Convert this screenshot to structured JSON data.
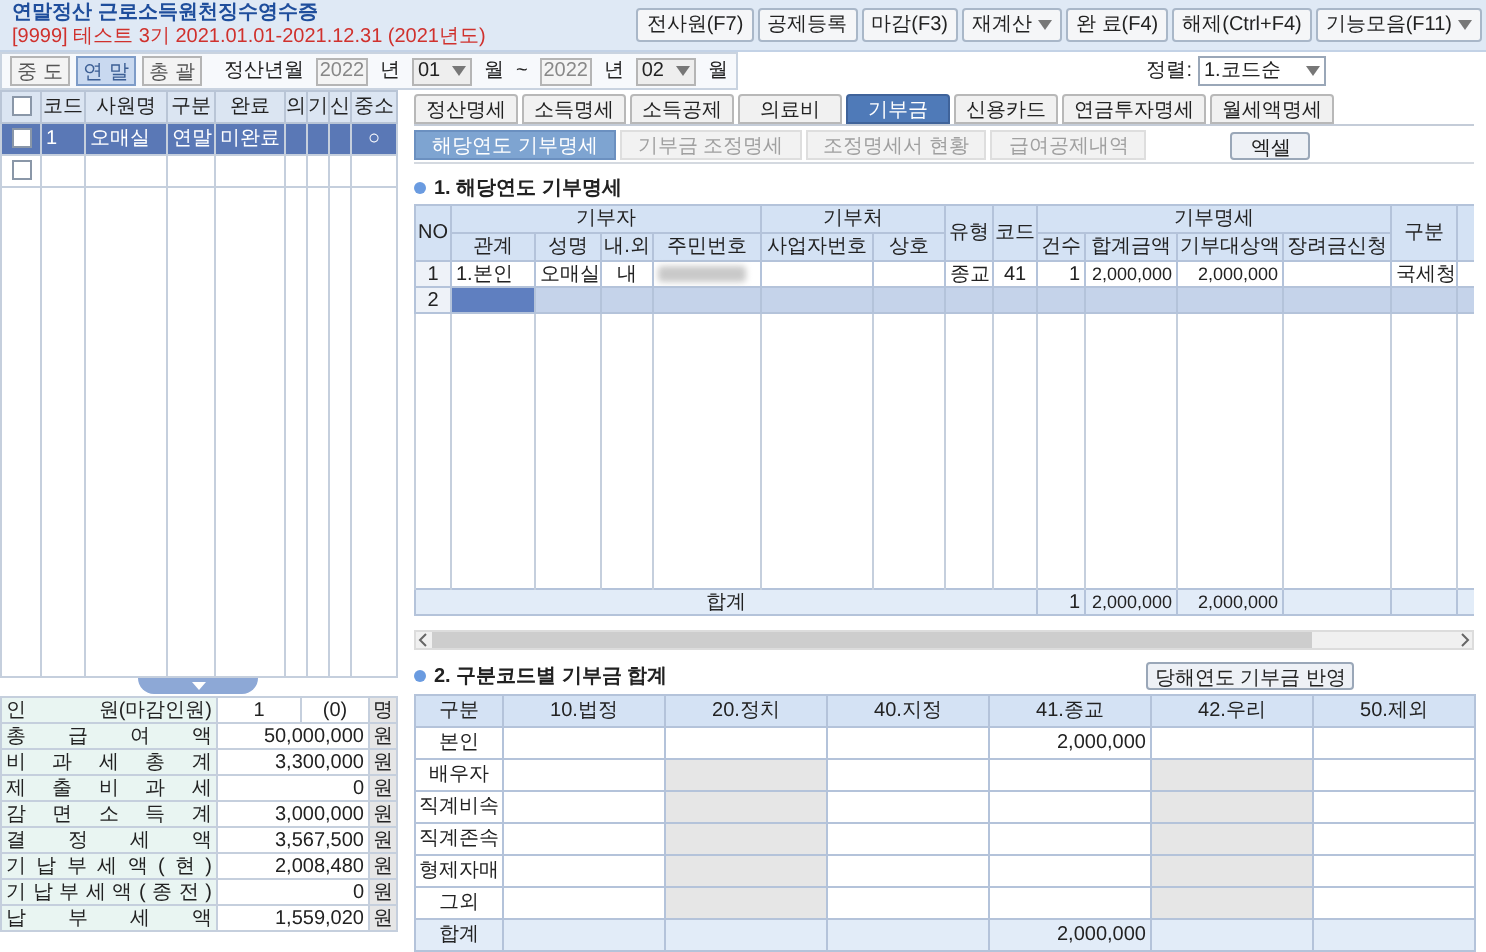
{
  "window": {
    "title": "연말정산 근로소득원천징수영수증",
    "company_period": "[9999] 테스트 3기 2021.01.01-2021.12.31 (2021년도)"
  },
  "toolbar": [
    {
      "label": "전사원(F7)",
      "dropdown": false
    },
    {
      "label": "공제등록",
      "dropdown": false
    },
    {
      "label": "마감(F3)",
      "dropdown": false
    },
    {
      "label": "재계산",
      "dropdown": true
    },
    {
      "label": "완 료(F4)",
      "dropdown": false
    },
    {
      "label": "해제(Ctrl+F4)",
      "dropdown": false
    },
    {
      "label": "기능모음(F11)",
      "dropdown": true
    }
  ],
  "modes": [
    {
      "label": "중 도",
      "selected": false
    },
    {
      "label": "연 말",
      "selected": true
    },
    {
      "label": "총 괄",
      "selected": false
    }
  ],
  "period": {
    "label": "정산년월",
    "from": {
      "year": "2022",
      "year_unit": "년",
      "month": "01",
      "month_unit": "월"
    },
    "separator": "~",
    "to": {
      "year": "2022",
      "year_unit": "년",
      "month": "02",
      "month_unit": "월"
    }
  },
  "sort": {
    "label": "정렬:",
    "value": "1.코드순"
  },
  "employees": {
    "all_checked": false,
    "columns": [
      "코드",
      "사원명",
      "구분",
      "완료",
      "의",
      "기",
      "신",
      "중소"
    ],
    "rows": [
      {
        "checked": false,
        "selected": true,
        "code": "1",
        "name": "오매실",
        "type": "연말",
        "status": "미완료",
        "sme": "○"
      },
      {
        "checked": false,
        "selected": false
      }
    ]
  },
  "summary": [
    {
      "label": "인 원(마감인원)",
      "value": "1",
      "value_2": "(0)",
      "unit": "명"
    },
    {
      "label": "총 급 여 액",
      "value": "50,000,000",
      "unit": "원"
    },
    {
      "label": "비 과 세 총 계",
      "value": "3,300,000",
      "unit": "원"
    },
    {
      "label": "제 출 비 과 세",
      "value": "0",
      "unit": "원"
    },
    {
      "label": "감 면 소 득 계",
      "value": "3,000,000",
      "unit": "원"
    },
    {
      "label": "결 정 세 액",
      "value": "3,567,500",
      "unit": "원"
    },
    {
      "label": "기 납 부 세 액 ( 현 )",
      "value": "2,008,480",
      "unit": "원"
    },
    {
      "label": "기 납 부 세 액 ( 종 전 )",
      "value": "0",
      "unit": "원"
    },
    {
      "label": "납 부 세 액",
      "value": "1,559,020",
      "unit": "원"
    }
  ],
  "tabs": [
    {
      "label": "정산명세",
      "selected": false
    },
    {
      "label": "소득명세",
      "selected": false
    },
    {
      "label": "소득공제",
      "selected": false
    },
    {
      "label": "의료비",
      "selected": false
    },
    {
      "label": "기부금",
      "selected": true
    },
    {
      "label": "신용카드",
      "selected": false
    },
    {
      "label": "연금투자명세",
      "selected": false
    },
    {
      "label": "월세액명세",
      "selected": false
    }
  ],
  "subtabs": [
    {
      "label": "해당연도 기부명세",
      "selected": true
    },
    {
      "label": "기부금 조정명세",
      "selected": false
    },
    {
      "label": "조정명세서 현황",
      "selected": false
    },
    {
      "label": "급여공제내역",
      "selected": false
    }
  ],
  "excel_button": "엑셀",
  "donations": {
    "title": "1. 해당연도 기부명세",
    "header": {
      "no": "NO",
      "donor": {
        "label": "기부자",
        "columns": [
          "관계",
          "성명",
          "내.외",
          "주민번호"
        ]
      },
      "recipient": {
        "label": "기부처",
        "columns": [
          "사업자번호",
          "상호"
        ]
      },
      "type": "유형",
      "code": "코드",
      "detail": {
        "label": "기부명세",
        "columns": [
          "건수",
          "합계금액",
          "기부대상액",
          "장려금신청"
        ]
      },
      "category": "구분"
    },
    "rows": [
      {
        "no": "1",
        "relation": "1.본인",
        "name": "오매실",
        "domestic": "내",
        "id_blurred": true,
        "type": "종교",
        "code": "41",
        "count": "1",
        "total": "2,000,000",
        "eligible": "2,000,000",
        "category": "국세청",
        "selected": false
      },
      {
        "no": "2",
        "selected": true
      }
    ],
    "total": {
      "label": "합계",
      "count": "1",
      "total": "2,000,000",
      "eligible": "2,000,000"
    }
  },
  "donation_totals": {
    "title": "2. 구분코드별 기부금 합계",
    "apply_button": "당해연도 기부금 반영",
    "label_header": "구분",
    "columns": [
      "10.법정",
      "20.정치",
      "40.지정",
      "41.종교",
      "42.우리",
      "50.제외"
    ],
    "rows": [
      {
        "label": "본인",
        "cells": [
          {
            "disabled": false
          },
          {
            "disabled": false
          },
          {
            "disabled": false
          },
          {
            "value": "2,000,000",
            "disabled": false
          },
          {
            "disabled": false
          },
          {
            "disabled": false
          }
        ]
      },
      {
        "label": "배우자",
        "cells": [
          {
            "disabled": false
          },
          {
            "disabled": true
          },
          {
            "disabled": false
          },
          {
            "disabled": false
          },
          {
            "disabled": true
          },
          {
            "disabled": false
          }
        ]
      },
      {
        "label": "직계비속",
        "cells": [
          {
            "disabled": false
          },
          {
            "disabled": true
          },
          {
            "disabled": false
          },
          {
            "disabled": false
          },
          {
            "disabled": true
          },
          {
            "disabled": false
          }
        ]
      },
      {
        "label": "직계존속",
        "cells": [
          {
            "disabled": false
          },
          {
            "disabled": true
          },
          {
            "disabled": false
          },
          {
            "disabled": false
          },
          {
            "disabled": true
          },
          {
            "disabled": false
          }
        ]
      },
      {
        "label": "형제자매",
        "cells": [
          {
            "disabled": false
          },
          {
            "disabled": true
          },
          {
            "disabled": false
          },
          {
            "disabled": false
          },
          {
            "disabled": true
          },
          {
            "disabled": false
          }
        ]
      },
      {
        "label": "그외",
        "cells": [
          {
            "disabled": false
          },
          {
            "disabled": true
          },
          {
            "disabled": false
          },
          {
            "disabled": false
          },
          {
            "disabled": true
          },
          {
            "disabled": false
          }
        ]
      }
    ],
    "total": {
      "label": "합계",
      "cells": [
        {
          "disabled": false
        },
        {
          "disabled": false
        },
        {
          "disabled": false
        },
        {
          "value": "2,000,000",
          "disabled": false
        },
        {
          "disabled": false
        },
        {
          "disabled": false
        }
      ]
    }
  }
}
